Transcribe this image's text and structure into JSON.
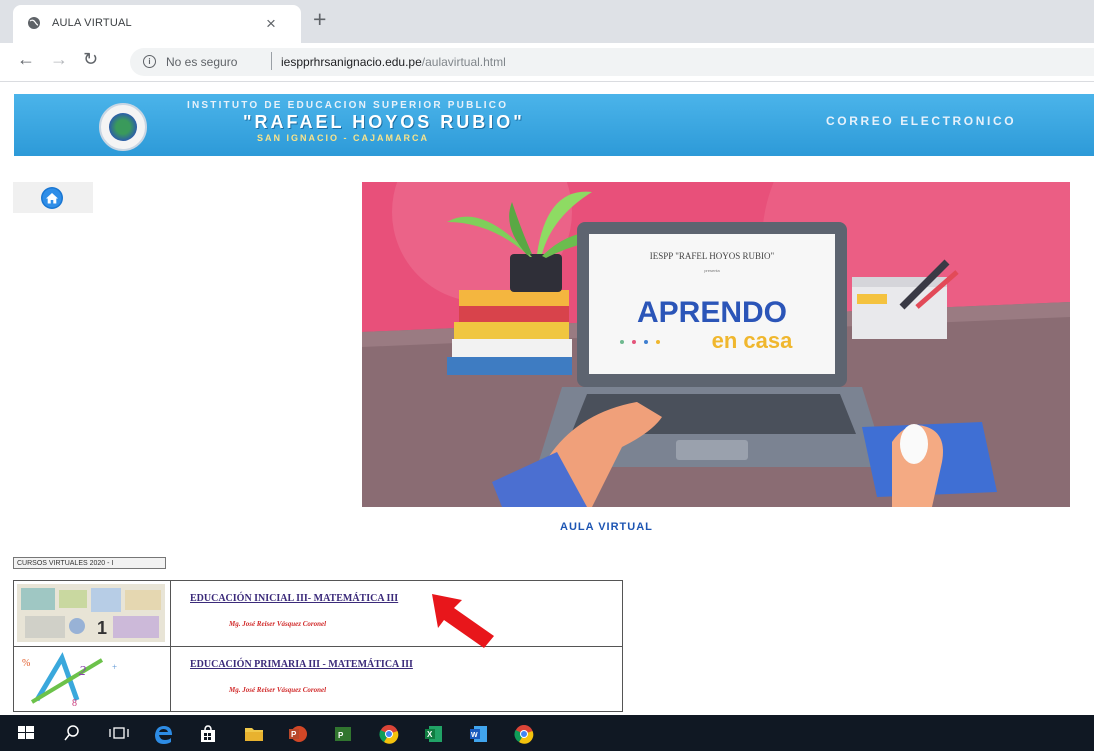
{
  "browser": {
    "tab_title": "AULA VIRTUAL",
    "tab_close": "×",
    "new_tab": "+",
    "security_text": "No es seguro",
    "url_host": "iespprhrsanignacio.edu.pe",
    "url_path": "/aulavirtual.html"
  },
  "header": {
    "line1": "INSTITUTO DE EDUCACION SUPERIOR PUBLICO",
    "line2": "\"RAFAEL HOYOS RUBIO\"",
    "line3": "SAN IGNACIO - CAJAMARCA",
    "mail_link": "CORREO ELECTRONICO"
  },
  "banner": {
    "screen_line": "IESPP \"RAFEL HOYOS RUBIO\"",
    "screen_small": "presenta",
    "title1": "APRENDO",
    "title2": "en casa"
  },
  "main": {
    "aula_title": "AULA VIRTUAL",
    "cursos_select": "CURSOS VIRTUALES 2020 - I"
  },
  "courses": [
    {
      "title": "EDUCACIÓN INICIAL III- MATEMÁTICA III",
      "teacher": "Mg. José Reiser Vásquez Coronel"
    },
    {
      "title": "EDUCACIÓN PRIMARIA III - MATEMÁTICA III",
      "teacher": "Mg. José Reiser Vásquez Coronel"
    }
  ],
  "colors": {
    "header_blue": "#3aa7e3",
    "banner_pink": "#e8507a",
    "arrow_red": "#e8161b",
    "link_purple": "#3b2a7a"
  }
}
